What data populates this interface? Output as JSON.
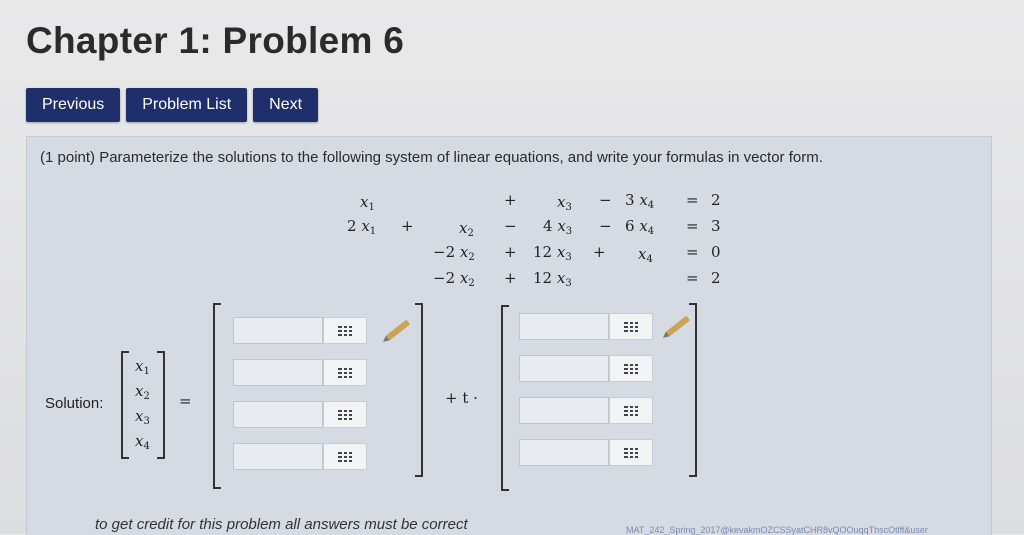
{
  "page": {
    "title": "Chapter 1: Problem 6"
  },
  "nav": {
    "previous": "Previous",
    "problem_list": "Problem List",
    "next": "Next"
  },
  "problem": {
    "prompt": "(1 point) Parameterize the solutions to the following system of linear equations, and write your formulas in vector form.",
    "equations": {
      "row1": {
        "x1": "x",
        "x1_sub": "1",
        "plus1": "+",
        "x3": "x",
        "x3_sub": "3",
        "op3": "−",
        "c4": "3",
        "x4": "x",
        "x4_sub": "4",
        "eq": "=",
        "rhs": "2"
      },
      "row2": {
        "c1": "2",
        "x1": "x",
        "x1_sub": "1",
        "plus0": "+",
        "x2": "x",
        "x2_sub": "2",
        "op2": "−",
        "c3": "4",
        "x3": "x",
        "x3_sub": "3",
        "op3": "−",
        "c4": "6",
        "x4": "x",
        "x4_sub": "4",
        "eq": "=",
        "rhs": "3"
      },
      "row3": {
        "c2": "−2",
        "x2": "x",
        "x2_sub": "2",
        "op2": "+",
        "c3": "12",
        "x3": "x",
        "x3_sub": "3",
        "op3": "+",
        "x4": "x",
        "x4_sub": "4",
        "eq": "=",
        "rhs": "0"
      },
      "row4": {
        "c2": "−2",
        "x2": "x",
        "x2_sub": "2",
        "op2": "+",
        "c3": "12",
        "x3": "x",
        "x3_sub": "3",
        "eq": "=",
        "rhs": "2"
      }
    },
    "solution_label": "Solution:",
    "vector_vars": [
      {
        "x": "x",
        "sub": "1"
      },
      {
        "x": "x",
        "sub": "2"
      },
      {
        "x": "x",
        "sub": "3"
      },
      {
        "x": "x",
        "sub": "4"
      }
    ],
    "equals": "=",
    "plus_t": "+ t ·",
    "inputs_left": [
      "",
      "",
      "",
      ""
    ],
    "inputs_right": [
      "",
      "",
      "",
      ""
    ]
  },
  "footer": {
    "note": "to get credit for this problem all answers must be correct",
    "right_text": "MAT_242_Spring_2017@kevakmOZCSSyatCHR8vQOOuqqThscOtlff&user"
  },
  "colors": {
    "nav_button": "#1f2f6b",
    "problem_bg": "#d6dbe3"
  },
  "icons": {
    "matrix_button": "grid-icon",
    "edit": "pencil-icon"
  }
}
